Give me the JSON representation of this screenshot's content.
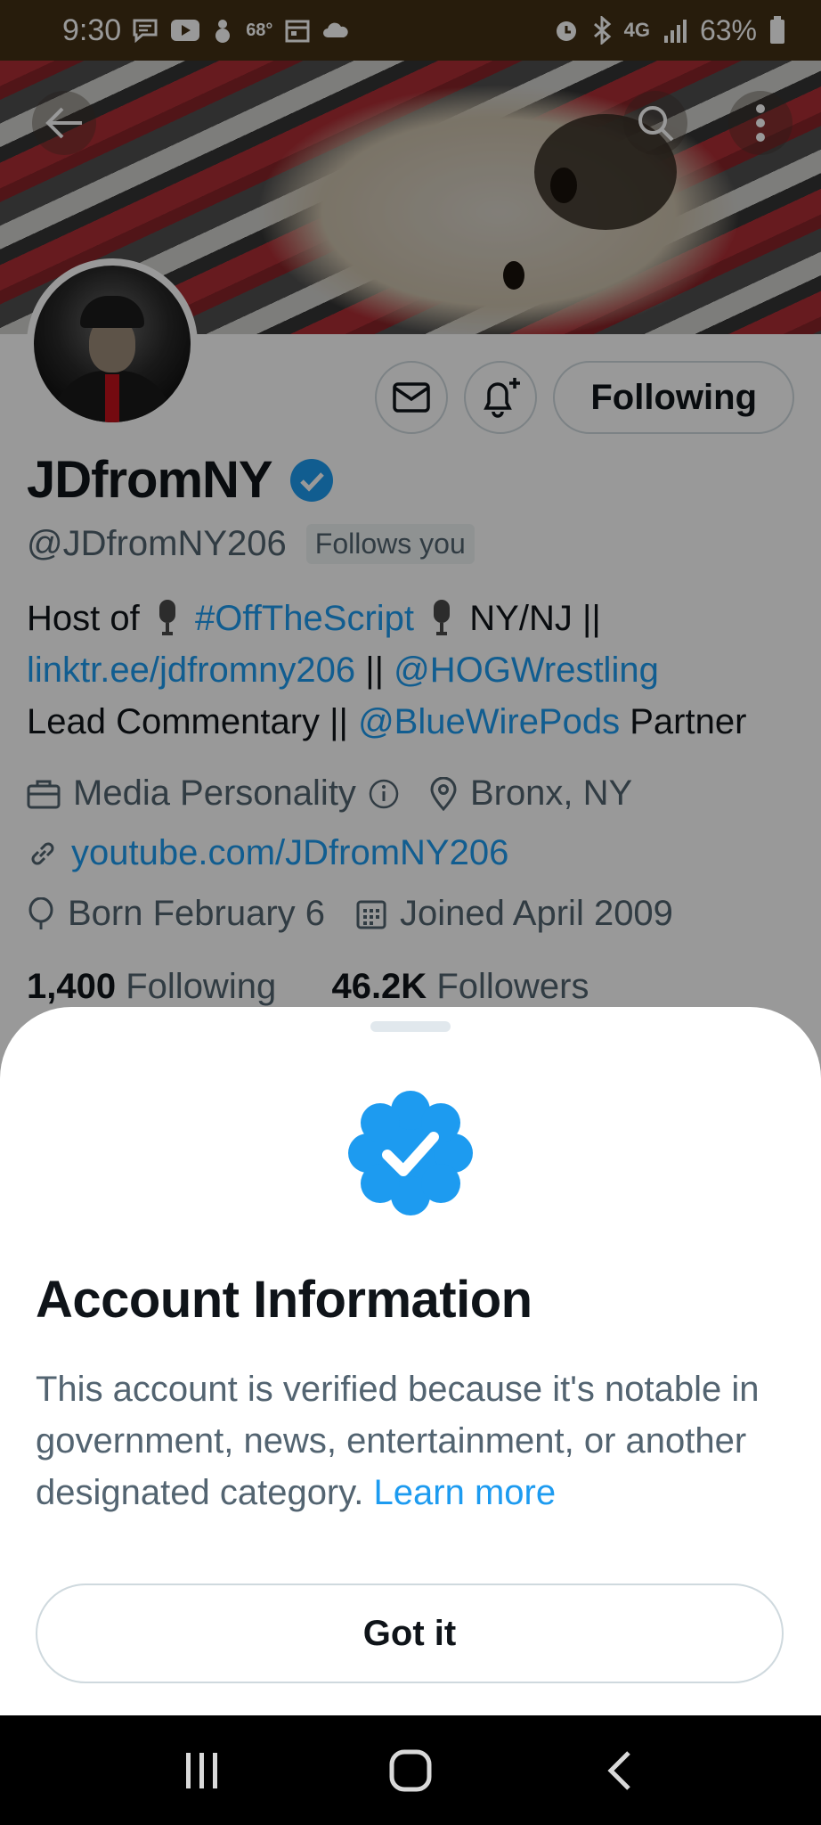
{
  "status_bar": {
    "time": "9:30",
    "temperature": "68°",
    "network": "4G",
    "battery": "63%",
    "icons_left": [
      "message-icon",
      "youtube-icon",
      "snowman-icon",
      "temperature-text",
      "calendar-icon",
      "cloud-icon"
    ],
    "icons_right": [
      "alarm-icon",
      "bluetooth-icon",
      "lte-icon",
      "signal-icon",
      "battery-icon"
    ]
  },
  "header": {
    "back_icon": "arrow-left-icon",
    "search_icon": "search-icon",
    "more_icon": "more-vertical-icon"
  },
  "profile": {
    "display_name": "JDfromNY",
    "handle": "@JDfromNY206",
    "follows_you": "Follows you",
    "following_button": "Following",
    "bio": {
      "host_of": "Host of",
      "hashtag": "#OffTheScript",
      "location_text": "NY/NJ ||",
      "linktree": "linktr.ee/jdfromny206",
      "sep1": "||",
      "hog_mention": "@HOGWrestling",
      "lead": "Lead Commentary ||",
      "bluewire_mention": "@BlueWirePods",
      "partner": "Partner"
    },
    "category": "Media Personality",
    "location": "Bronx, NY",
    "website": "youtube.com/JDfromNY206",
    "birthday": "Born February 6",
    "joined": "Joined April 2009",
    "following_count": "1,400",
    "following_label": "Following",
    "followers_count": "46.2K",
    "followers_label": "Followers"
  },
  "sheet": {
    "title": "Account Information",
    "body": "This account is verified because it's notable in government, news, entertainment, or another designated category.",
    "learn_more": "Learn more",
    "button": "Got it"
  },
  "colors": {
    "accent": "#1d9bf0",
    "text_primary": "#0f1419",
    "text_secondary": "#536471",
    "status_bar": "#412f14"
  }
}
